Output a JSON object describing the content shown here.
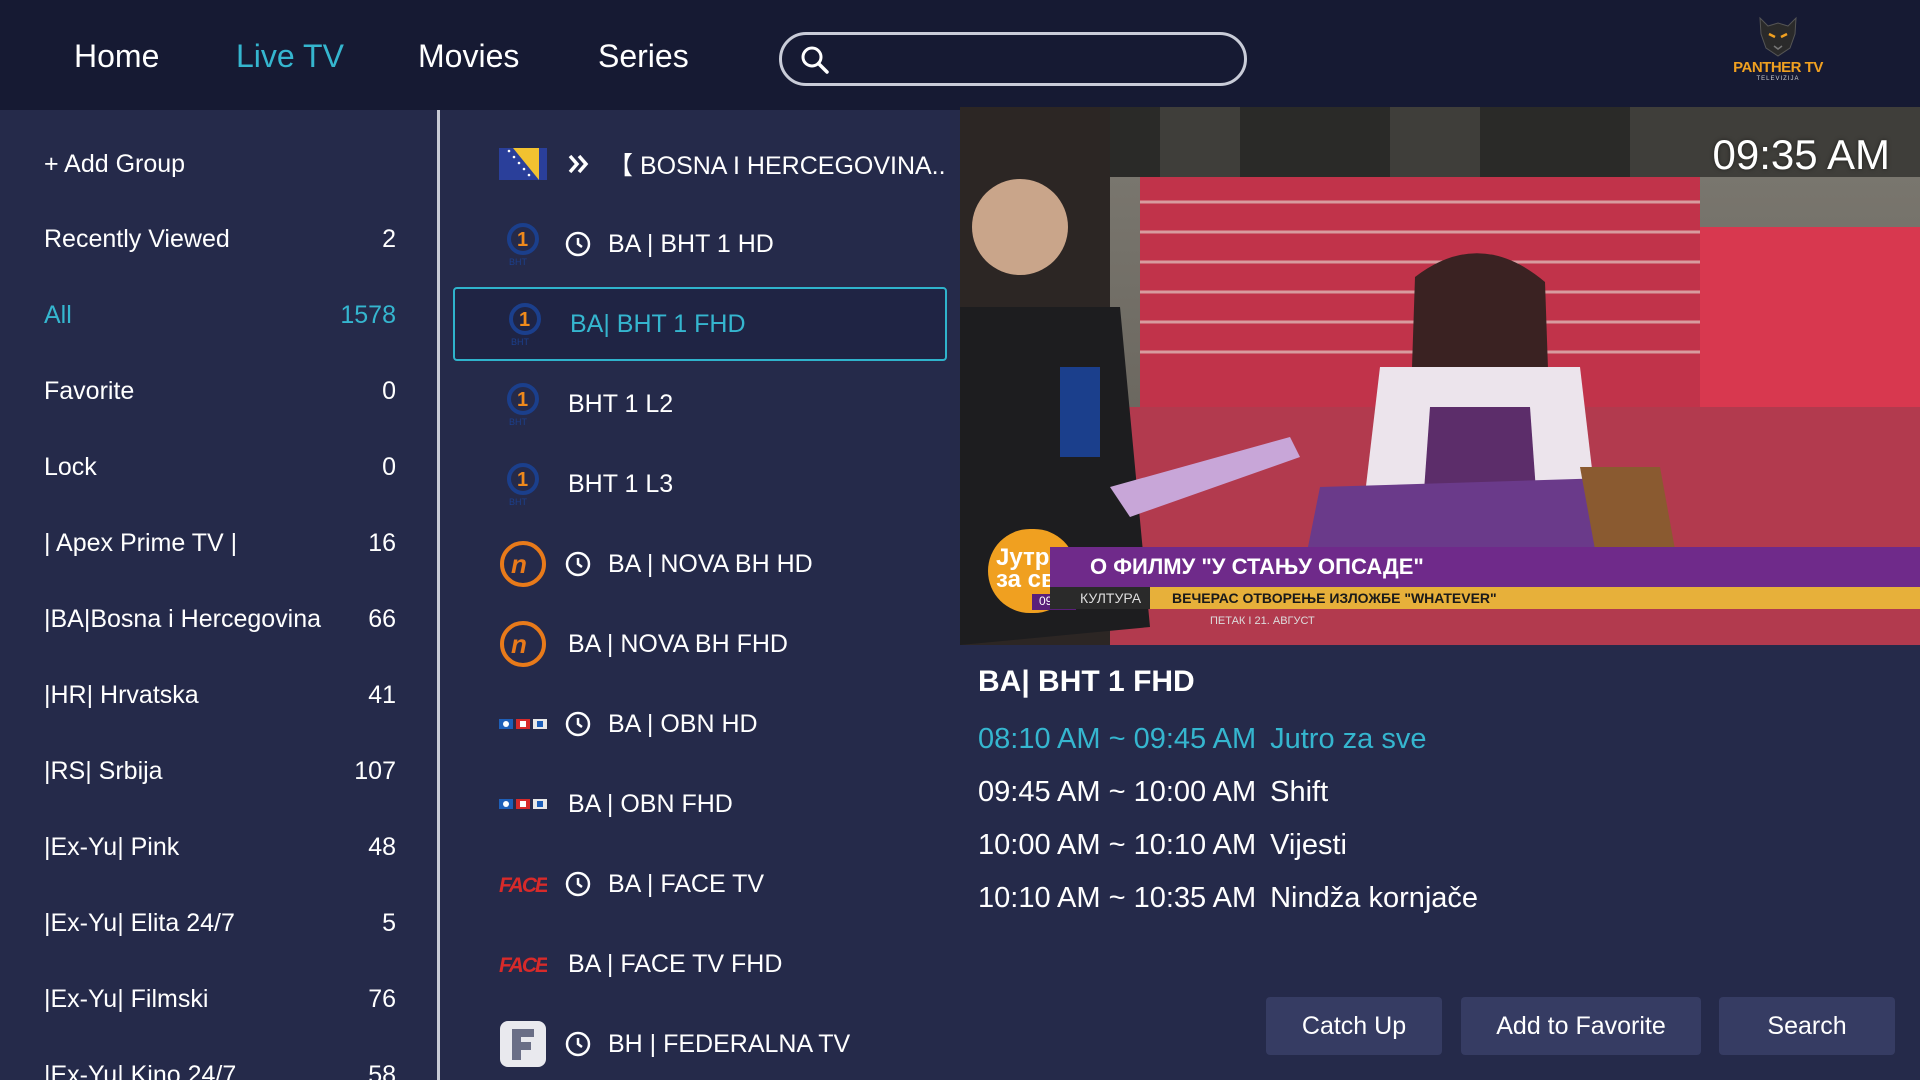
{
  "nav": {
    "items": [
      {
        "label": "Home",
        "active": false
      },
      {
        "label": "Live TV",
        "active": true
      },
      {
        "label": "Movies",
        "active": false
      },
      {
        "label": "Series",
        "active": false
      }
    ],
    "search_placeholder": "",
    "logo_text": "PANTHER TV",
    "logo_sub": "TELEVIZIJA",
    "accent_color": "#35b6cf"
  },
  "groups": {
    "add_label": "+ Add Group",
    "items": [
      {
        "name": "Recently Viewed",
        "count": "2"
      },
      {
        "name": "All",
        "count": "1578",
        "active": true
      },
      {
        "name": "Favorite",
        "count": "0"
      },
      {
        "name": "Lock",
        "count": "0"
      },
      {
        "name": "| Apex Prime  TV  |",
        "count": "16"
      },
      {
        "name": "|BA|Bosna i Hercegovina",
        "count": "66"
      },
      {
        "name": "|HR| Hrvatska",
        "count": "41"
      },
      {
        "name": "|RS| Srbija",
        "count": "107"
      },
      {
        "name": "|Ex-Yu| Pink",
        "count": "48"
      },
      {
        "name": "|Ex-Yu| Elita 24/7",
        "count": "5"
      },
      {
        "name": "|Ex-Yu| Filmski",
        "count": "76"
      },
      {
        "name": "|Ex-Yu| Kino 24/7",
        "count": "58"
      }
    ]
  },
  "channels": [
    {
      "name": "【 BOSNA I HERCEGOVINA..",
      "logo": "bosnia-flag-icon",
      "marker": "double-chevron-icon"
    },
    {
      "name": "BA | BHT 1 HD",
      "logo": "bht1-logo",
      "clock": true
    },
    {
      "name": "BA| BHT 1 FHD",
      "logo": "bht1-logo",
      "selected": true
    },
    {
      "name": "BHT 1 L2",
      "logo": "bht1-logo"
    },
    {
      "name": "BHT 1 L3",
      "logo": "bht1-logo"
    },
    {
      "name": "BA | NOVA BH HD",
      "logo": "nova-logo",
      "clock": true
    },
    {
      "name": "BA | NOVA BH FHD",
      "logo": "nova-logo"
    },
    {
      "name": "BA | OBN HD",
      "logo": "obn-logo",
      "clock": true
    },
    {
      "name": "BA | OBN FHD",
      "logo": "obn-logo"
    },
    {
      "name": "BA | FACE TV",
      "logo": "face-logo",
      "clock": true
    },
    {
      "name": "BA | FACE TV FHD",
      "logo": "face-logo"
    },
    {
      "name": "BH | FEDERALNA TV",
      "logo": "federalna-logo",
      "clock": true
    }
  ],
  "player": {
    "clock": "09:35 AM",
    "ticker_title": "О ФИЛМУ \"У СТАЊУ ОПСАДЕ\"",
    "ticker_category": "КУЛТУРА",
    "ticker_news": "ВЕЧЕРАС ОТВОРЕЊЕ ИЗЛОЖБЕ \"WHATEVER\"",
    "ticker_date": "ПЕТАК   I   21. АВГУСТ",
    "show_badge": "Јутро за све",
    "show_time": "09:34"
  },
  "epg": {
    "channel_title": "BA| BHT 1 FHD",
    "programs": [
      {
        "time": "08:10 AM ~ 09:45 AM",
        "title": "Jutro za sve",
        "current": true
      },
      {
        "time": "09:45 AM ~ 10:00 AM",
        "title": "Shift"
      },
      {
        "time": "10:00 AM ~ 10:10 AM",
        "title": "Vijesti"
      },
      {
        "time": "10:10 AM ~ 10:35 AM",
        "title": "Nindža kornjače"
      }
    ]
  },
  "actions": {
    "catch_up": "Catch Up",
    "add_favorite": "Add to Favorite",
    "search": "Search"
  }
}
